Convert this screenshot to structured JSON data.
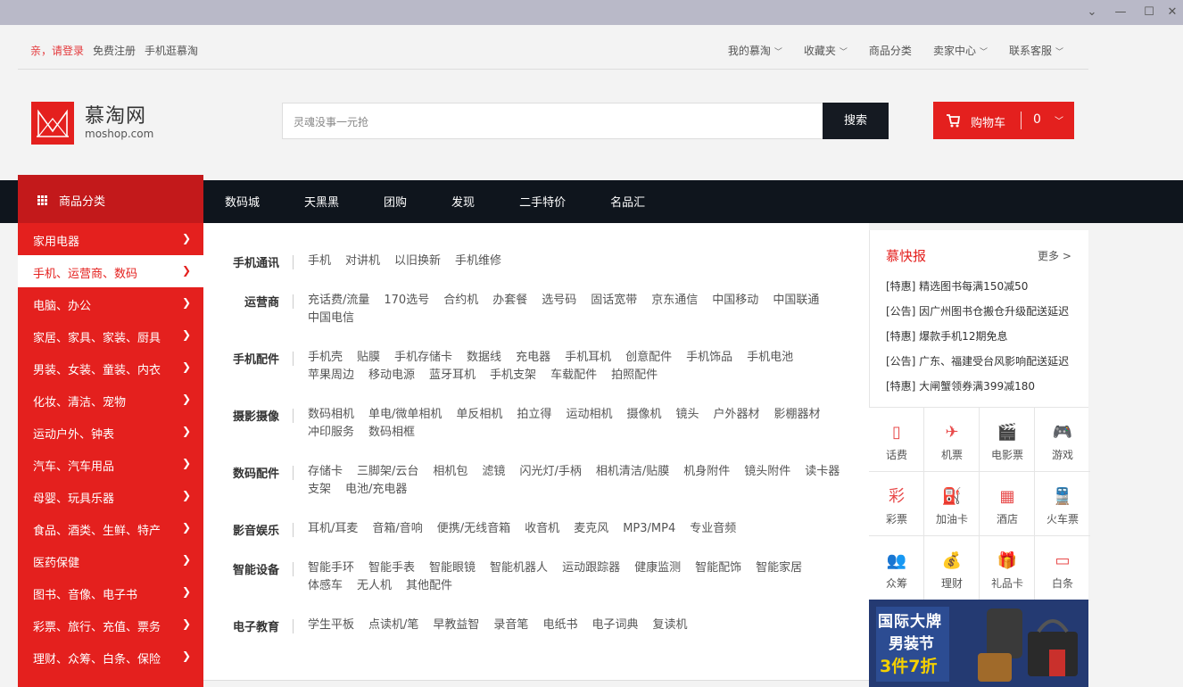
{
  "topbar": {
    "login": "亲，请登录",
    "register": "免费注册",
    "mobile": "手机逛慕淘",
    "my_moshop": "我的慕淘",
    "favorites": "收藏夹",
    "categories": "商品分类",
    "seller_center": "卖家中心",
    "support": "联系客服"
  },
  "logo": {
    "cn": "慕淘网",
    "en": "moshop.com"
  },
  "search": {
    "placeholder": "灵魂没事一元抢",
    "button": "搜索"
  },
  "cart": {
    "label": "购物车",
    "count": "0"
  },
  "nav": {
    "category_head": "商品分类",
    "links": [
      "数码城",
      "天黑黑",
      "团购",
      "发现",
      "二手特价",
      "名品汇"
    ]
  },
  "categories": [
    "家用电器",
    "手机、运营商、数码",
    "电脑、办公",
    "家居、家具、家装、厨具",
    "男装、女装、童装、内衣",
    "化妆、清洁、宠物",
    "运动户外、钟表",
    "汽车、汽车用品",
    "母婴、玩具乐器",
    "食品、酒类、生鲜、特产",
    "医药保健",
    "图书、音像、电子书",
    "彩票、旅行、充值、票务",
    "理财、众筹、白条、保险"
  ],
  "active_category_index": 1,
  "panel": {
    "rows": [
      {
        "label": "手机通讯",
        "links": [
          "手机",
          "对讲机",
          "以旧换新",
          "手机维修"
        ]
      },
      {
        "label": "运营商",
        "links": [
          "充话费/流量",
          "170选号",
          "合约机",
          "办套餐",
          "选号码",
          "固话宽带",
          "京东通信",
          "中国移动",
          "中国联通",
          "中国电信"
        ]
      },
      {
        "label": "手机配件",
        "links": [
          "手机壳",
          "贴膜",
          "手机存储卡",
          "数据线",
          "充电器",
          "手机耳机",
          "创意配件",
          "手机饰品",
          "手机电池",
          "苹果周边",
          "移动电源",
          "蓝牙耳机",
          "手机支架",
          "车载配件",
          "拍照配件"
        ]
      },
      {
        "label": "摄影摄像",
        "links": [
          "数码相机",
          "单电/微单相机",
          "单反相机",
          "拍立得",
          "运动相机",
          "摄像机",
          "镜头",
          "户外器材",
          "影棚器材",
          "冲印服务",
          "数码相框"
        ]
      },
      {
        "label": "数码配件",
        "links": [
          "存储卡",
          "三脚架/云台",
          "相机包",
          "滤镜",
          "闪光灯/手柄",
          "相机清洁/贴膜",
          "机身附件",
          "镜头附件",
          "读卡器",
          "支架",
          "电池/充电器"
        ]
      },
      {
        "label": "影音娱乐",
        "links": [
          "耳机/耳麦",
          "音箱/音响",
          "便携/无线音箱",
          "收音机",
          "麦克风",
          "MP3/MP4",
          "专业音频"
        ]
      },
      {
        "label": "智能设备",
        "links": [
          "智能手环",
          "智能手表",
          "智能眼镜",
          "智能机器人",
          "运动跟踪器",
          "健康监测",
          "智能配饰",
          "智能家居",
          "体感车",
          "无人机",
          "其他配件"
        ]
      },
      {
        "label": "电子教育",
        "links": [
          "学生平板",
          "点读机/笔",
          "早教益智",
          "录音笔",
          "电纸书",
          "电子词典",
          "复读机"
        ]
      }
    ]
  },
  "news": {
    "title": "慕快报",
    "more": "更多 >",
    "items": [
      "[特惠] 精选图书每满150减50",
      "[公告] 因广州图书仓搬仓升级配送延迟",
      "[特惠] 爆款手机12期免息",
      "[公告] 广东、福建受台风影响配送延迟",
      "[特惠] 大闸蟹领券满399减180"
    ]
  },
  "services": [
    {
      "label": "话费",
      "icon": "phone-bill-icon"
    },
    {
      "label": "机票",
      "icon": "airplane-icon"
    },
    {
      "label": "电影票",
      "icon": "movie-clapper-icon"
    },
    {
      "label": "游戏",
      "icon": "gamepad-icon"
    },
    {
      "label": "彩票",
      "icon": "lottery-icon"
    },
    {
      "label": "加油卡",
      "icon": "gas-pump-icon"
    },
    {
      "label": "酒店",
      "icon": "hotel-icon"
    },
    {
      "label": "火车票",
      "icon": "train-icon"
    },
    {
      "label": "众筹",
      "icon": "crowdfunding-icon"
    },
    {
      "label": "理财",
      "icon": "money-bag-icon"
    },
    {
      "label": "礼品卡",
      "icon": "gift-icon"
    },
    {
      "label": "白条",
      "icon": "credit-icon"
    }
  ],
  "banner": {
    "line1": "国际大牌",
    "line2": "男装节",
    "line3": "3件7折"
  },
  "colors": {
    "brand_red": "#e4201e",
    "dark_nav": "#0f151d",
    "cat_head": "#c3191b"
  }
}
